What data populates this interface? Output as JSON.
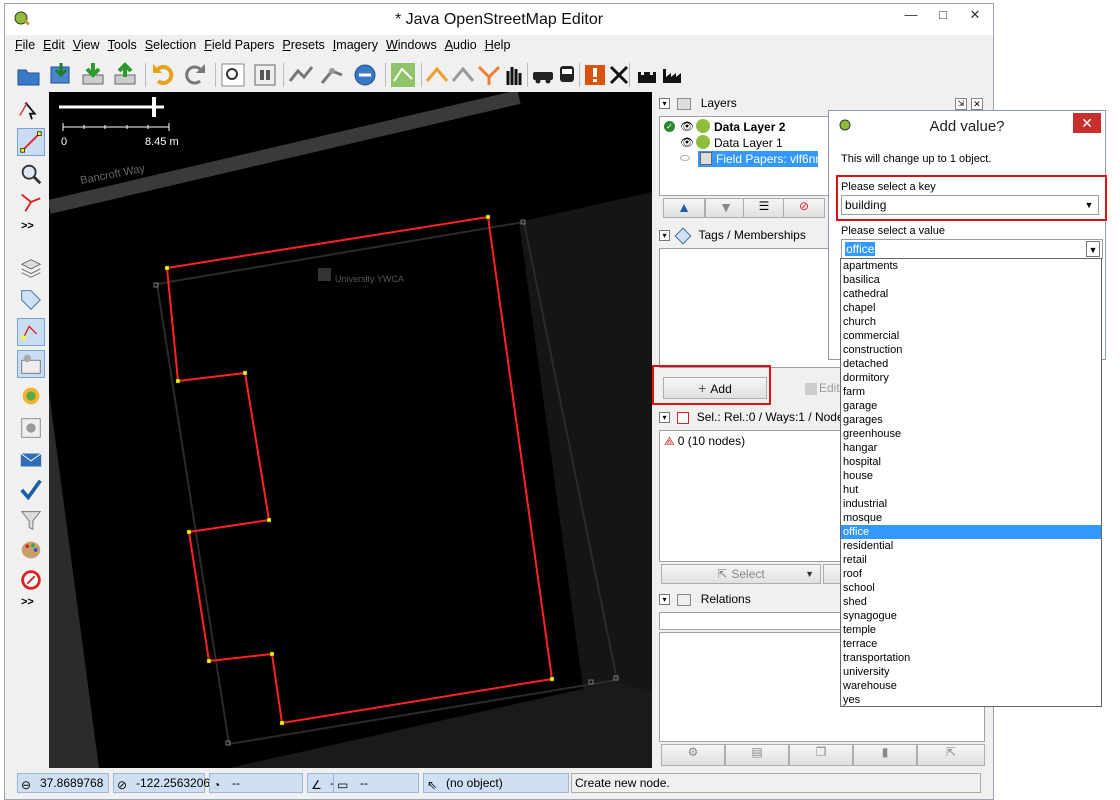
{
  "window": {
    "title": "* Java OpenStreetMap Editor",
    "min": "—",
    "max": "□",
    "close": "✕"
  },
  "menu": [
    "File",
    "Edit",
    "View",
    "Tools",
    "Selection",
    "Field Papers",
    "Presets",
    "Imagery",
    "Windows",
    "Audio",
    "Help"
  ],
  "map": {
    "scale_start": "0",
    "scale_end": "8.45 m",
    "road_label": "Bancroft Way",
    "poi_label": "University YWCA"
  },
  "left_more_1": ">>",
  "left_more_2": ">>",
  "layers": {
    "header": "Layers",
    "items": [
      {
        "name": "Data Layer 2",
        "bold": true
      },
      {
        "name": "Data Layer 1",
        "bold": false
      },
      {
        "name": "Field Papers: vlf6nr5c",
        "bold": false
      }
    ]
  },
  "tags": {
    "header": "Tags / Memberships",
    "add_label": "Add",
    "edit_label": "Edit"
  },
  "selection": {
    "header": "Sel.: Rel.:0 / Ways:1 / Nodes:",
    "item": "0 (10 nodes)",
    "select_label": "Select"
  },
  "relations": {
    "header": "Relations"
  },
  "status": {
    "lat": "37.8689768",
    "lon": "-122.2563206",
    "heading": "--",
    "angle": "--",
    "distance": "--",
    "object": "(no object)",
    "message": "Create new node."
  },
  "dialog": {
    "title": "Add value?",
    "info": "This will change up to 1 object.",
    "key_label": "Please select a key",
    "key_value": "building",
    "value_label": "Please select a value",
    "value_value": "office",
    "options": [
      "apartments",
      "basilica",
      "cathedral",
      "chapel",
      "church",
      "commercial",
      "construction",
      "detached",
      "dormitory",
      "farm",
      "garage",
      "garages",
      "greenhouse",
      "hangar",
      "hospital",
      "house",
      "hut",
      "industrial",
      "mosque",
      "office",
      "residential",
      "retail",
      "roof",
      "school",
      "shed",
      "synagogue",
      "temple",
      "terrace",
      "transportation",
      "university",
      "warehouse",
      "yes"
    ],
    "selected_option": "office"
  },
  "colors": {
    "highlight": "#3399ff",
    "annotation": "#dd1111",
    "way": "#ff2222",
    "node": "#ffff00"
  }
}
